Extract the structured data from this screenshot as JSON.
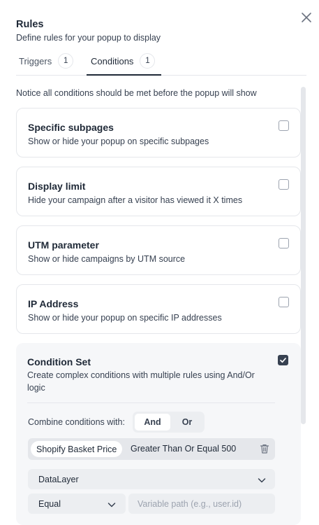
{
  "header": {
    "title": "Rules",
    "subtitle": "Define rules for your popup to display"
  },
  "tabs": [
    {
      "label": "Triggers",
      "count": "1",
      "active": false
    },
    {
      "label": "Conditions",
      "count": "1",
      "active": true
    }
  ],
  "notice": "Notice all conditions should be met before the popup will show",
  "conditions": [
    {
      "title": "Specific subpages",
      "description": "Show or hide your popup on specific subpages",
      "checked": false
    },
    {
      "title": "Display limit",
      "description": "Hide your campaign after a visitor has viewed it X times",
      "checked": false
    },
    {
      "title": "UTM parameter",
      "description": "Show or hide campaigns by UTM source",
      "checked": false
    },
    {
      "title": "IP Address",
      "description": "Show or hide your popup on specific IP addresses",
      "checked": false
    }
  ],
  "condition_set": {
    "title": "Condition Set",
    "description": "Create complex conditions with multiple rules using And/Or logic",
    "checked": true,
    "combine_label": "Combine conditions with:",
    "and_label": "And",
    "or_label": "Or",
    "rule": {
      "chip": "Shopify Basket Price",
      "text": "Greater Than Or Equal 500"
    },
    "source_select": "DataLayer",
    "operator_select": "Equal",
    "path_placeholder": "Variable path (e.g., user.id)"
  },
  "colors": {
    "text": "#1f2937",
    "muted": "#374151",
    "border": "#e5e7eb",
    "checkbox_checked": "#374151"
  }
}
